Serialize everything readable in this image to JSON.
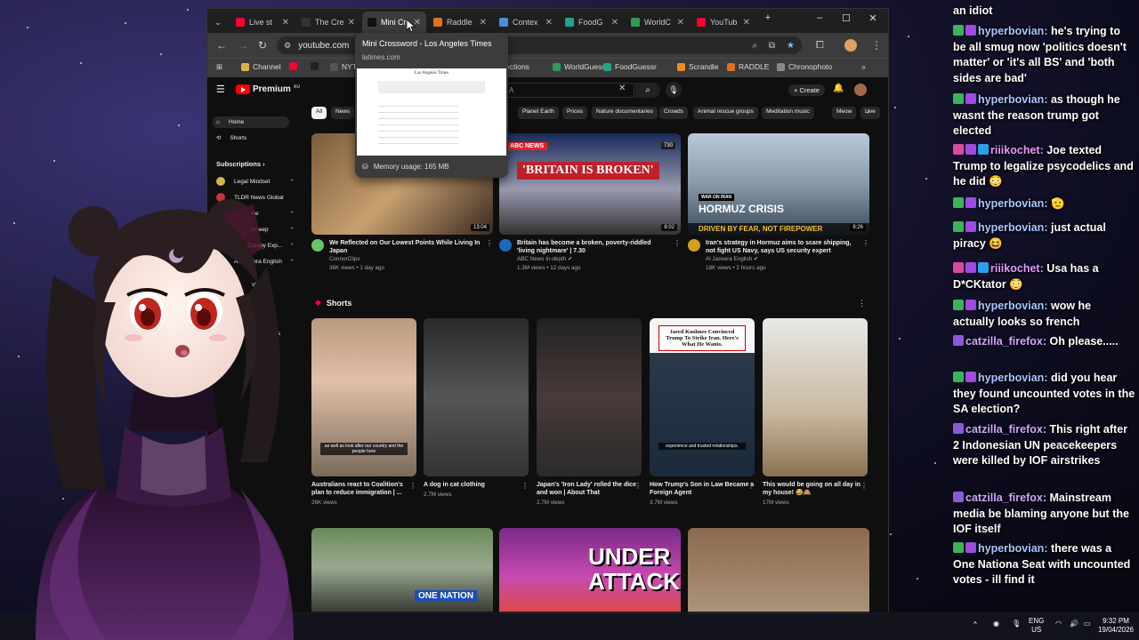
{
  "browser": {
    "tabs": [
      {
        "label": "Live st",
        "color": "#ff0033"
      },
      {
        "label": "The Cre",
        "color": "#333333"
      },
      {
        "label": "Mini Cr",
        "color": "#111111",
        "active": true
      },
      {
        "label": "Raddle",
        "color": "#e2711d"
      },
      {
        "label": "Contex",
        "color": "#4a90d9"
      },
      {
        "label": "FoodG",
        "color": "#22a38a"
      },
      {
        "label": "WorldC",
        "color": "#2e9d5b"
      },
      {
        "label": "YouTub",
        "color": "#ff0033"
      }
    ],
    "url": "youtube.com",
    "bookmarks": [
      {
        "label": "Channel",
        "color": "#d9b24a"
      },
      {
        "label": "",
        "color": "#ff0033"
      },
      {
        "label": "",
        "color": "#222222"
      },
      {
        "label": "NYT",
        "color": "#555555"
      },
      {
        "label": "ections",
        "color": ""
      },
      {
        "label": "WorldGuessr",
        "color": "#2e9d5b"
      },
      {
        "label": "FoodGuessr",
        "color": "#22a38a"
      },
      {
        "label": "Scrandle",
        "color": "#f08a24"
      },
      {
        "label": "RADDLE",
        "color": "#e2711d"
      },
      {
        "label": "Chronophoto",
        "color": "#8a8a8a"
      }
    ],
    "tooltip": {
      "title": "Mini Crossword - Los Angeles Times",
      "domain": "latimes.com",
      "memory": "Memory usage: 165 MB",
      "preview_header": "Los Angeles Times"
    }
  },
  "youtube": {
    "premium": "Premium",
    "region": "AU",
    "search_value": "A",
    "create_label": "Create",
    "sidebar": {
      "home": "Home",
      "shorts": "Shorts",
      "subscriptions": "Subscriptions",
      "subs": [
        "Legal Mindset",
        "TLDR News Global",
        "Pax Tube",
        "melodysheep",
        "True Creepy Exp...",
        "Al Jazeera English"
      ],
      "partial": [
        "st: F",
        "eos",
        "deos",
        "Downloads",
        "usic",
        "ies & TV",
        "more",
        "Tube",
        "emium"
      ]
    },
    "chips": [
      "All",
      "News",
      "Planet Earth",
      "Prices",
      "Nature documentaries",
      "Crowds",
      "Animal rescue groups",
      "Meditation music",
      "Meow",
      "Live"
    ],
    "videos": [
      {
        "title": "We Reflected on Our Lowest Points While Living In Japan",
        "channel": "ConnorClips",
        "stats": "36K views • 1 day ago",
        "duration": "13:04",
        "avatar": "#6ac26a",
        "thumb_text": ""
      },
      {
        "title": "Britain has become a broken, poverty-riddled 'living nightmare' | 7.30",
        "channel": "ABC News In-depth ✔",
        "stats": "1.3M views • 12 days ago",
        "duration": "8:02",
        "avatar": "#1b6ab8",
        "thumb_text": "'BRITAIN IS BROKEN'",
        "thumb_badge": "ABC NEWS",
        "thumb_corner": "730"
      },
      {
        "title": "Iran's strategy in Hormuz aims to scare shipping, not fight US Navy, says US security expert",
        "channel": "Al Jazeera English ✔",
        "stats": "18K views • 2 hours ago",
        "duration": "8:26",
        "avatar": "#d4a017",
        "thumb_text": "HORMUZ CRISIS",
        "thumb_sub": "DRIVEN BY FEAR, NOT FIREPOWER",
        "thumb_tag": "WAR ON IRAN"
      }
    ],
    "shorts_title": "Shorts",
    "shorts": [
      {
        "title": "Australians react to Coalition's plan to reduce immigration | ...",
        "views": "26K views",
        "caption": "as well as look after our country and the people here"
      },
      {
        "title": "A dog in cat clothing",
        "views": "2.7M views",
        "caption": ""
      },
      {
        "title": "Japan's 'Iron Lady' rolled the dice and won | About That",
        "views": "2.7M views",
        "caption": ""
      },
      {
        "title": "How Trump's Son in Law Became a Foreign Agent",
        "views": "3.7M views",
        "caption": "experience and trusted relationships.",
        "headline": "Jared Kushner Convinced Trump To Strike Iran. Here's What He Wants."
      },
      {
        "title": "This would be going on all day in my house! 😂🙈",
        "views": "17M views",
        "caption": ""
      }
    ],
    "bottom_videos": [
      {
        "thumb_text": "ONE NATION"
      },
      {
        "thumb_text": "UNDER ATTACK"
      },
      {
        "thumb_text": ""
      }
    ]
  },
  "chat": [
    {
      "user": "",
      "text": "an idiot",
      "kind": "cont"
    },
    {
      "user": "hyperbovian:",
      "text": "he's trying to be all smug now 'politics doesn't matter' or 'it's all BS' and 'both sides are bad'",
      "kind": "hyper"
    },
    {
      "user": "hyperbovian:",
      "text": "as though he wasnt the reason trump got elected",
      "kind": "hyper"
    },
    {
      "user": "riiikochet:",
      "text": "Joe texted Trump to legalize psycodelics and he did 😳",
      "kind": "riil"
    },
    {
      "user": "hyperbovian:",
      "text": "🫡",
      "kind": "hyper"
    },
    {
      "user": "hyperbovian:",
      "text": "just actual piracy 😆",
      "kind": "hyper"
    },
    {
      "user": "riiikochet:",
      "text": "Usa has a D*CKtator 😳",
      "kind": "riil"
    },
    {
      "user": "hyperbovian:",
      "text": "wow he actually looks so french",
      "kind": "hyper"
    },
    {
      "user": "catzilla_firefox:",
      "text": "Oh please.....",
      "kind": "cat"
    },
    {
      "user": "hyperbovian:",
      "text": "did you hear they found uncounted votes in the SA election?",
      "kind": "hyper"
    },
    {
      "user": "catzilla_firefox:",
      "text": "This right after 2 Indonesian UN peacekeepers were killed by IOF airstrikes",
      "kind": "cat"
    },
    {
      "user": "catzilla_firefox:",
      "text": "Mainstream media be blaming anyone but the IOF itself",
      "kind": "cat"
    },
    {
      "user": "hyperbovian:",
      "text": "there was a One Nationa Seat with uncounted votes - ill find it",
      "kind": "hyper"
    }
  ],
  "taskbar": {
    "lang": "ENG",
    "region": "US",
    "time": "9:32 PM",
    "date": "19/04/2026"
  }
}
